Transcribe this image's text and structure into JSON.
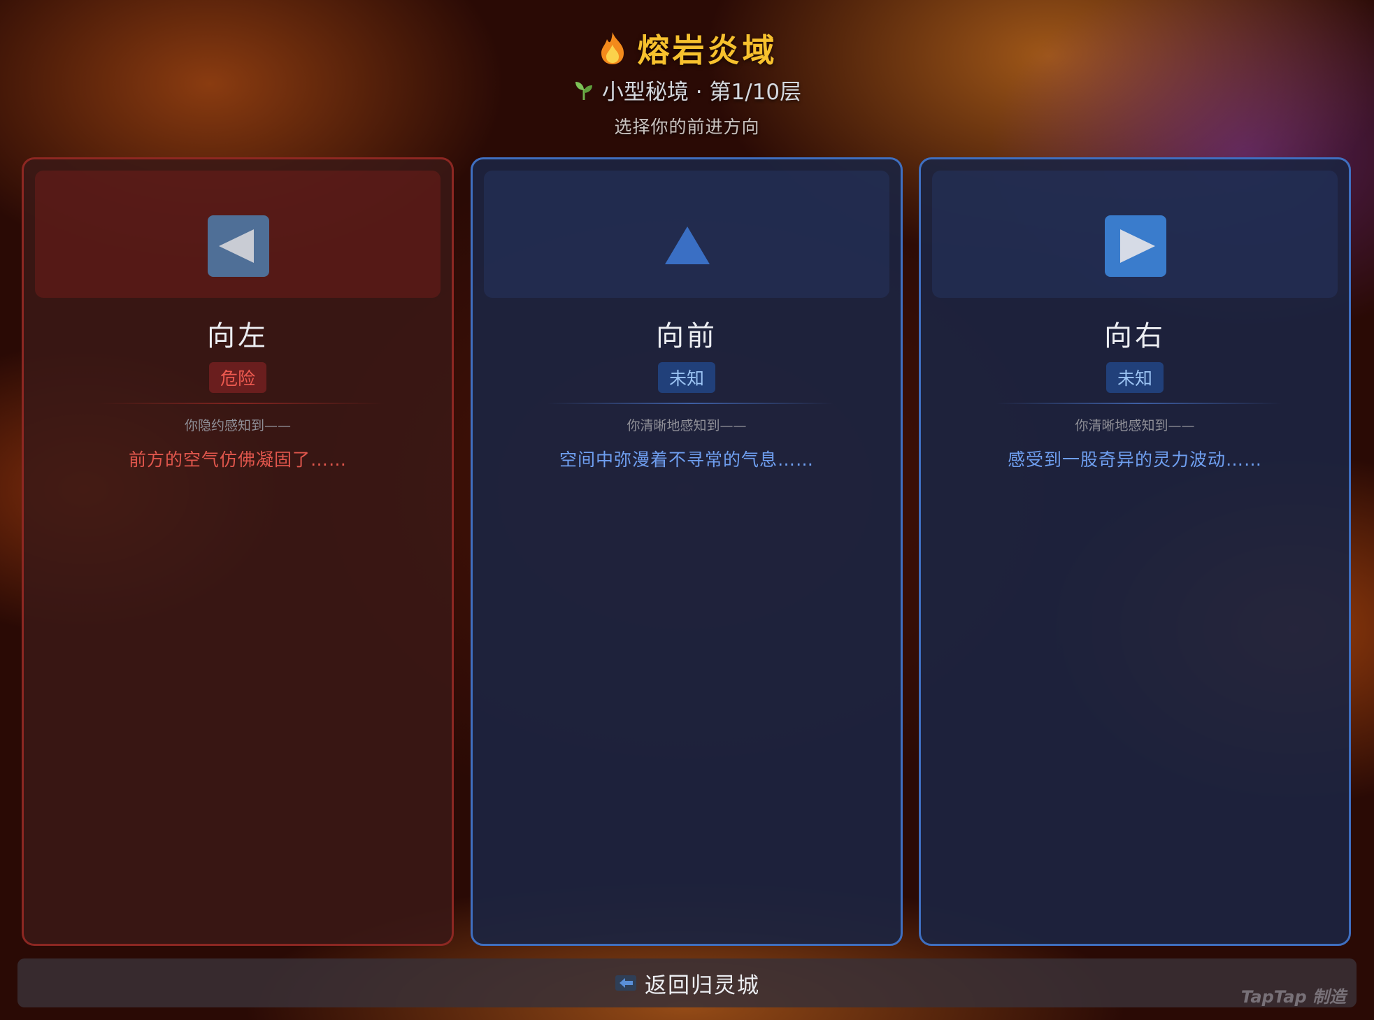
{
  "header": {
    "icon": "fire-icon",
    "title": "熔岩炎域",
    "subtitle_icon": "sprout-icon",
    "subtitle": "小型秘境 · 第1/10层",
    "hint": "选择你的前进方向"
  },
  "directions": [
    {
      "label": "向左",
      "arrow_icon": "left-arrow-icon",
      "badge": "危险",
      "sense_label": "你隐约感知到——",
      "sense_text": "前方的空气仿佛凝固了……",
      "status": "danger"
    },
    {
      "label": "向前",
      "arrow_icon": "up-arrow-icon",
      "badge": "未知",
      "sense_label": "你清晰地感知到——",
      "sense_text": "空间中弥漫着不寻常的气息……",
      "status": "unknown"
    },
    {
      "label": "向右",
      "arrow_icon": "right-arrow-icon",
      "badge": "未知",
      "sense_label": "你清晰地感知到——",
      "sense_text": "感受到一股奇异的灵力波动……",
      "status": "unknown"
    }
  ],
  "footer": {
    "back_icon": "back-arrow-icon",
    "back_label": "返回归灵城",
    "watermark": "TapTap 制造"
  },
  "colors": {
    "title": "#f7c12e",
    "danger_border": "#aa2d28",
    "unknown_border": "#3f6fc0",
    "danger_text": "#e0564c",
    "unknown_text": "#6f9ff0"
  }
}
